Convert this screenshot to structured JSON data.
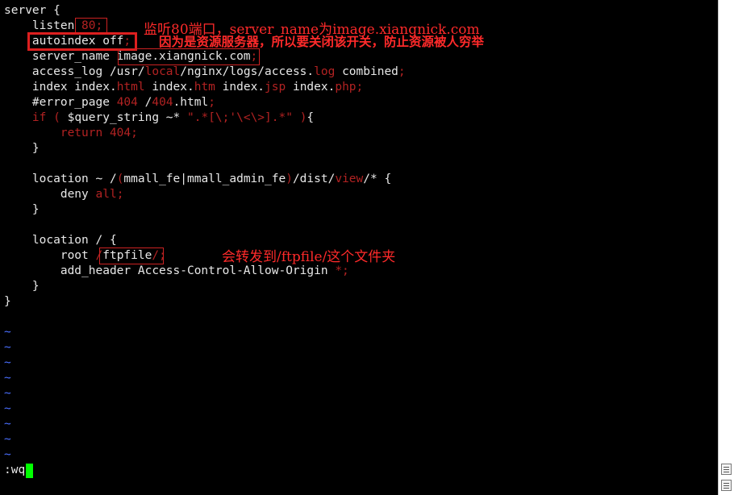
{
  "editor": {
    "command_line": ":wq",
    "lines": [
      "server {",
      "    listen 80;",
      "    autoindex off;",
      "    server_name image.xiangnick.com;",
      "    access_log /usr/local/nginx/logs/access.log combined;",
      "    index index.html index.htm index.jsp index.php;",
      "    #error_page 404 /404.html;",
      "    if ( $query_string ~* \".*[\\;'\\<\\>].*\" ){",
      "        return 404;",
      "    }",
      "",
      "    location ~ /(mmall_fe|mmall_admin_fe)/dist/view/* {",
      "        deny all;",
      "    }",
      "",
      "    location / {",
      "        root /ftpfile/;",
      "        add_header Access-Control-Allow-Origin *;",
      "    }",
      "}",
      "",
      "~",
      "~",
      "~",
      "~",
      "~",
      "~",
      "~",
      "~",
      "~"
    ]
  },
  "annotations": {
    "listen_note": "监听80端口，server_name为image.xiangnick.com",
    "autoindex_note": "因为是资源服务器，所以要关闭该开关，防止资源被人穷举",
    "root_note": "会转发到/ftpfile/这个文件夹"
  },
  "colors": {
    "background": "#000000",
    "text": "#e8e8e8",
    "keyword_red": "#b22222",
    "tilde_blue": "#4a6fff",
    "cursor_green": "#00ff00",
    "annotation_red": "#ff2a2a"
  }
}
